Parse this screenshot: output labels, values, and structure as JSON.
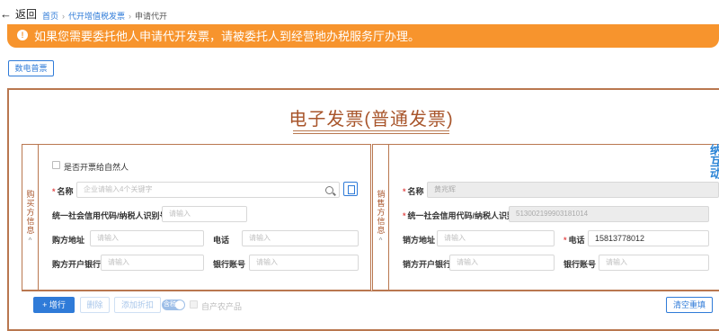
{
  "topbar": {
    "back_label": "返回",
    "breadcrumb": [
      "首页",
      "代开增值税发票",
      "申请代开"
    ]
  },
  "notice": {
    "text": "如果您需要委托他人申请代开发票，请被委托人到经营地办税服务厅办理。"
  },
  "invoice_type_button": "数电普票",
  "form_title": "电子发票(普通发票)",
  "buyer": {
    "section_label": "购买方信息",
    "natural_person_label": "是否开票给自然人",
    "name_label": "名称",
    "name_placeholder": "企业请输入4个关键字",
    "credit_code_label": "统一社会信用代码/纳税人识别号",
    "credit_code_placeholder": "请输入",
    "address_label": "购方地址",
    "address_placeholder": "请输入",
    "phone_label": "电话",
    "phone_placeholder": "请输入",
    "bank_label": "购方开户银行",
    "bank_placeholder": "请输入",
    "account_label": "银行账号",
    "account_placeholder": "请输入"
  },
  "seller": {
    "section_label": "销售方信息",
    "name_label": "名称",
    "name_value": "黄兆辉",
    "credit_code_label": "统一社会信用代码/纳税人识别号",
    "credit_code_value": "513002199903181014",
    "address_label": "销方地址",
    "address_placeholder": "请输入",
    "phone_label": "电话",
    "phone_value": "15813778012",
    "bank_label": "销方开户银行",
    "bank_placeholder": "请输入",
    "account_label": "银行账号",
    "account_placeholder": "请输入"
  },
  "actions": {
    "add_label": "增行",
    "delete_label": "删除",
    "add_discount_label": "添加折扣",
    "toggle_label": "含税",
    "agri_label": "自产农产品",
    "clear_label": "清空重填"
  },
  "side_widget_text": "纳互动",
  "colors": {
    "accent": "#2f7bd8",
    "notice_bg": "#f7942d",
    "frame": "#b9774f",
    "title": "#a8552b",
    "required": "#e34d4d"
  }
}
